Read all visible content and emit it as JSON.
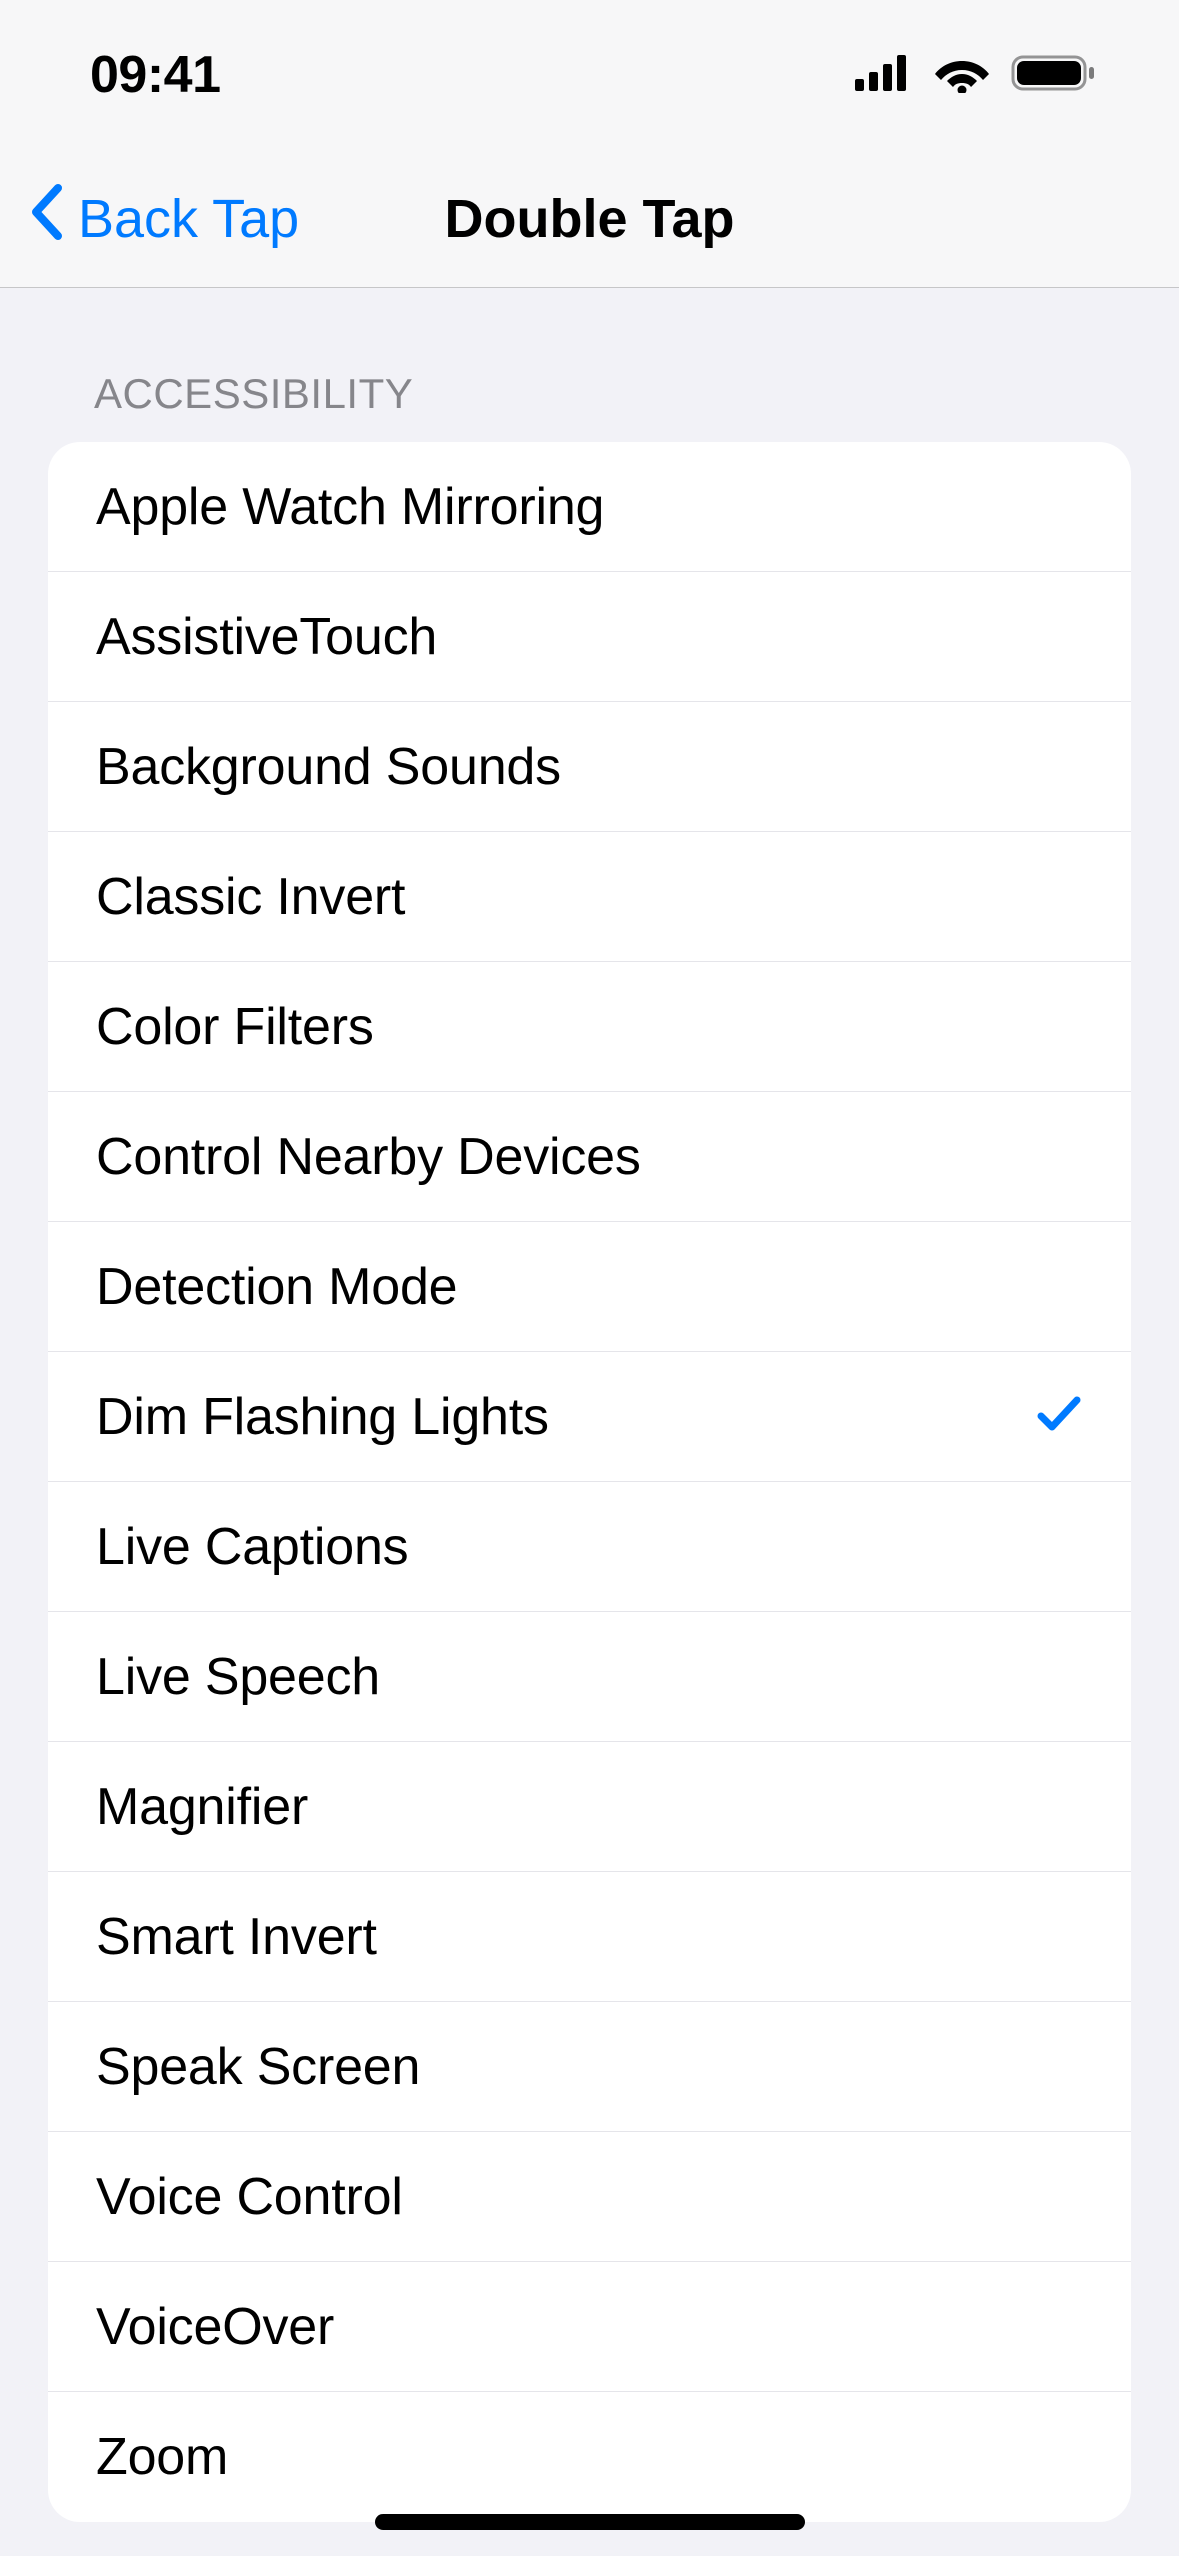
{
  "statusBar": {
    "time": "09:41"
  },
  "navBar": {
    "backLabel": "Back Tap",
    "title": "Double Tap"
  },
  "section": {
    "header": "Accessibility",
    "items": [
      {
        "label": "Apple Watch Mirroring",
        "selected": false
      },
      {
        "label": "AssistiveTouch",
        "selected": false
      },
      {
        "label": "Background Sounds",
        "selected": false
      },
      {
        "label": "Classic Invert",
        "selected": false
      },
      {
        "label": "Color Filters",
        "selected": false
      },
      {
        "label": "Control Nearby Devices",
        "selected": false
      },
      {
        "label": "Detection Mode",
        "selected": false
      },
      {
        "label": "Dim Flashing Lights",
        "selected": true
      },
      {
        "label": "Live Captions",
        "selected": false
      },
      {
        "label": "Live Speech",
        "selected": false
      },
      {
        "label": "Magnifier",
        "selected": false
      },
      {
        "label": "Smart Invert",
        "selected": false
      },
      {
        "label": "Speak Screen",
        "selected": false
      },
      {
        "label": "Voice Control",
        "selected": false
      },
      {
        "label": "VoiceOver",
        "selected": false
      },
      {
        "label": "Zoom",
        "selected": false
      }
    ]
  }
}
